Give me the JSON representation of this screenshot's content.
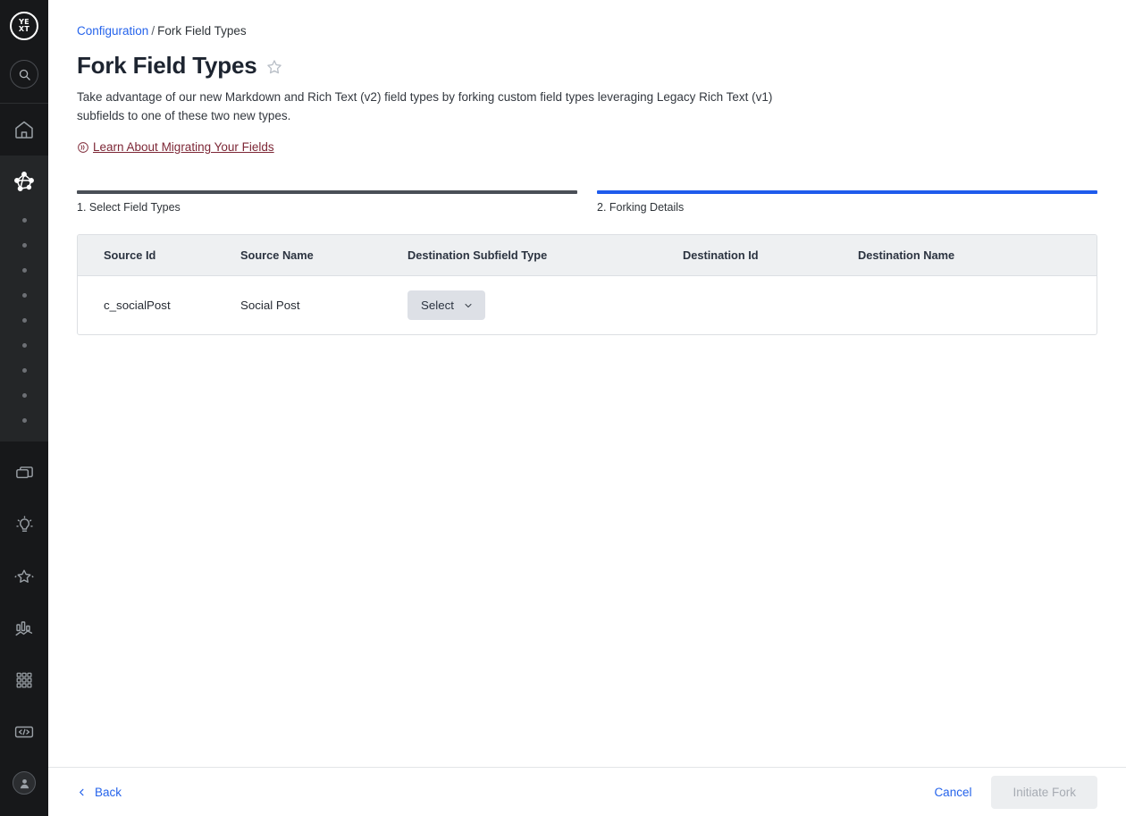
{
  "sidebar": {
    "logo": {
      "icon": "yext-logo-icon",
      "line1": "YE",
      "line2": "XT"
    },
    "search": {
      "icon": "search-icon"
    },
    "items": [
      {
        "icon": "home-icon",
        "name": "sidebar-item-home"
      },
      {
        "icon": "knowledge-graph-icon",
        "name": "sidebar-item-knowledge-graph",
        "active": true
      }
    ],
    "subnav_dots": 9,
    "lower_items": [
      {
        "icon": "pages-icon",
        "name": "sidebar-item-pages"
      },
      {
        "icon": "lightbulb-icon",
        "name": "sidebar-item-search"
      },
      {
        "icon": "star-icon",
        "name": "sidebar-item-reviews"
      },
      {
        "icon": "analytics-icon",
        "name": "sidebar-item-analytics"
      },
      {
        "icon": "grid-apps-icon",
        "name": "sidebar-item-apps"
      },
      {
        "icon": "code-icon",
        "name": "sidebar-item-developer"
      }
    ],
    "account": {
      "icon": "user-avatar-icon",
      "name": "sidebar-account-avatar"
    }
  },
  "breadcrumb": {
    "parent": "Configuration",
    "separator": "/",
    "current": "Fork Field Types"
  },
  "header": {
    "title": "Fork Field Types",
    "favorite_icon": "star-outline-icon",
    "description": "Take advantage of our new Markdown and Rich Text (v2) field types by forking custom field types leveraging Legacy Rich Text (v1) subfields to one of these two new types.",
    "learn_link": {
      "icon": "guide-badge-icon",
      "label": "Learn About Migrating Your Fields",
      "color": "#7d2736"
    }
  },
  "stepper": {
    "steps": [
      {
        "label": "1. Select Field Types",
        "state": "completed",
        "color": "#4a4f57"
      },
      {
        "label": "2. Forking Details",
        "state": "active",
        "color": "#1e5bec"
      }
    ]
  },
  "table": {
    "columns": [
      "Source Id",
      "Source Name",
      "Destination Subfield Type",
      "Destination Id",
      "Destination Name"
    ],
    "rows": [
      {
        "source_id": "c_socialPost",
        "source_name": "Social Post",
        "destination_subfield_type": "Select",
        "destination_subfield_icon": "chevron-down-icon",
        "destination_id": "",
        "destination_name": ""
      }
    ]
  },
  "footer": {
    "back": {
      "label": "Back",
      "icon": "chevron-left-icon"
    },
    "cancel": {
      "label": "Cancel"
    },
    "primary": {
      "label": "Initiate Fork",
      "disabled": true
    }
  },
  "colors": {
    "accent_blue": "#2563eb",
    "step_active": "#1e5bec",
    "step_done": "#4a4f57",
    "sidebar_bg": "#17181a",
    "table_header_bg": "#eef0f2",
    "link_maroon": "#7d2736"
  }
}
